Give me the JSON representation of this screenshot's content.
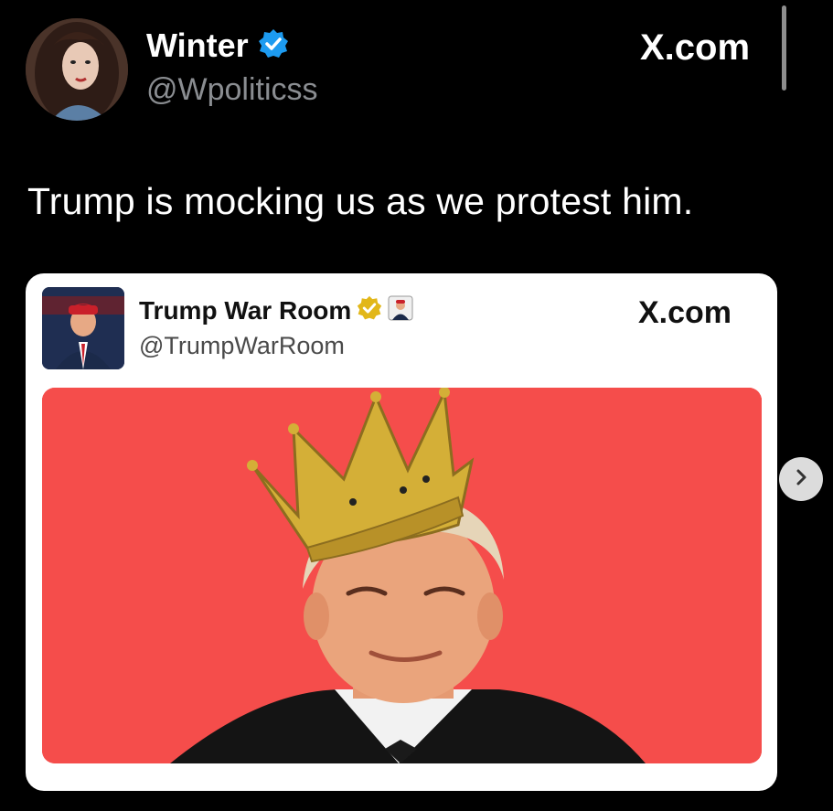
{
  "post": {
    "author_name": "Winter",
    "author_handle": "@Wpoliticss",
    "source_label": "X.com",
    "text": "Trump is mocking us as we protest him.",
    "verified_icon": "verified-badge-blue"
  },
  "embedded_post": {
    "author_name": "Trump War Room",
    "author_handle": "@TrumpWarRoom",
    "source_label": "X.com",
    "verified_icon": "verified-badge-gold",
    "affiliate_icon": "affiliate-avatar-badge",
    "media_description_icon": "image-crowned-man-on-red"
  },
  "colors": {
    "background": "#000000",
    "card": "#ffffff",
    "media_background": "#f54d4b",
    "verified_blue": "#1d9bf0",
    "verified_gold": "#e2b719",
    "handle_gray": "#8a8d91"
  },
  "navigation": {
    "next_icon": "chevron-right-icon"
  }
}
